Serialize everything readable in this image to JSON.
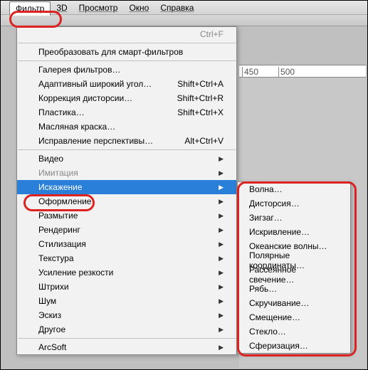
{
  "menubar": {
    "filter": "Фильтр",
    "threeD": "3D",
    "view": "Просмотр",
    "window": "Окно",
    "help": "Справка"
  },
  "dropdown": {
    "lastFilter": {
      "label": "",
      "shortcut": "Ctrl+F"
    },
    "convertSmart": "Преобразовать для смарт-фильтров",
    "filterGallery": "Галерея фильтров…",
    "adaptiveWide": {
      "label": "Адаптивный широкий угол…",
      "shortcut": "Shift+Ctrl+A"
    },
    "lensCorrection": {
      "label": "Коррекция дисторсии…",
      "shortcut": "Shift+Ctrl+R"
    },
    "liquify": {
      "label": "Пластика…",
      "shortcut": "Shift+Ctrl+X"
    },
    "oilPaint": "Масляная краска…",
    "vanishingPoint": {
      "label": "Исправление перспективы…",
      "shortcut": "Alt+Ctrl+V"
    },
    "video": "Видео",
    "imitation": "Имитация",
    "distort": "Искажение",
    "pixelate": "Оформление",
    "blur": "Размытие",
    "render": "Рендеринг",
    "stylize": "Стилизация",
    "texture": "Текстура",
    "sharpen": "Усиление резкости",
    "strokes": "Штрихи",
    "noise": "Шум",
    "sketch": "Эскиз",
    "other": "Другое",
    "arcsoft": "ArcSoft"
  },
  "submenu": {
    "wave": "Волна…",
    "distortion": "Дисторсия…",
    "zigzag": "Зигзаг…",
    "shear": "Искривление…",
    "oceanRipple": "Океанские волны…",
    "polar": "Полярные координаты…",
    "diffuseGlow": "Рассеянное свечение…",
    "ripple": "Рябь…",
    "twirl": "Скручивание…",
    "displace": "Смещение…",
    "glass": "Стекло…",
    "spherize": "Сферизация…"
  },
  "ruler": {
    "t450": "450",
    "t500": "500"
  }
}
